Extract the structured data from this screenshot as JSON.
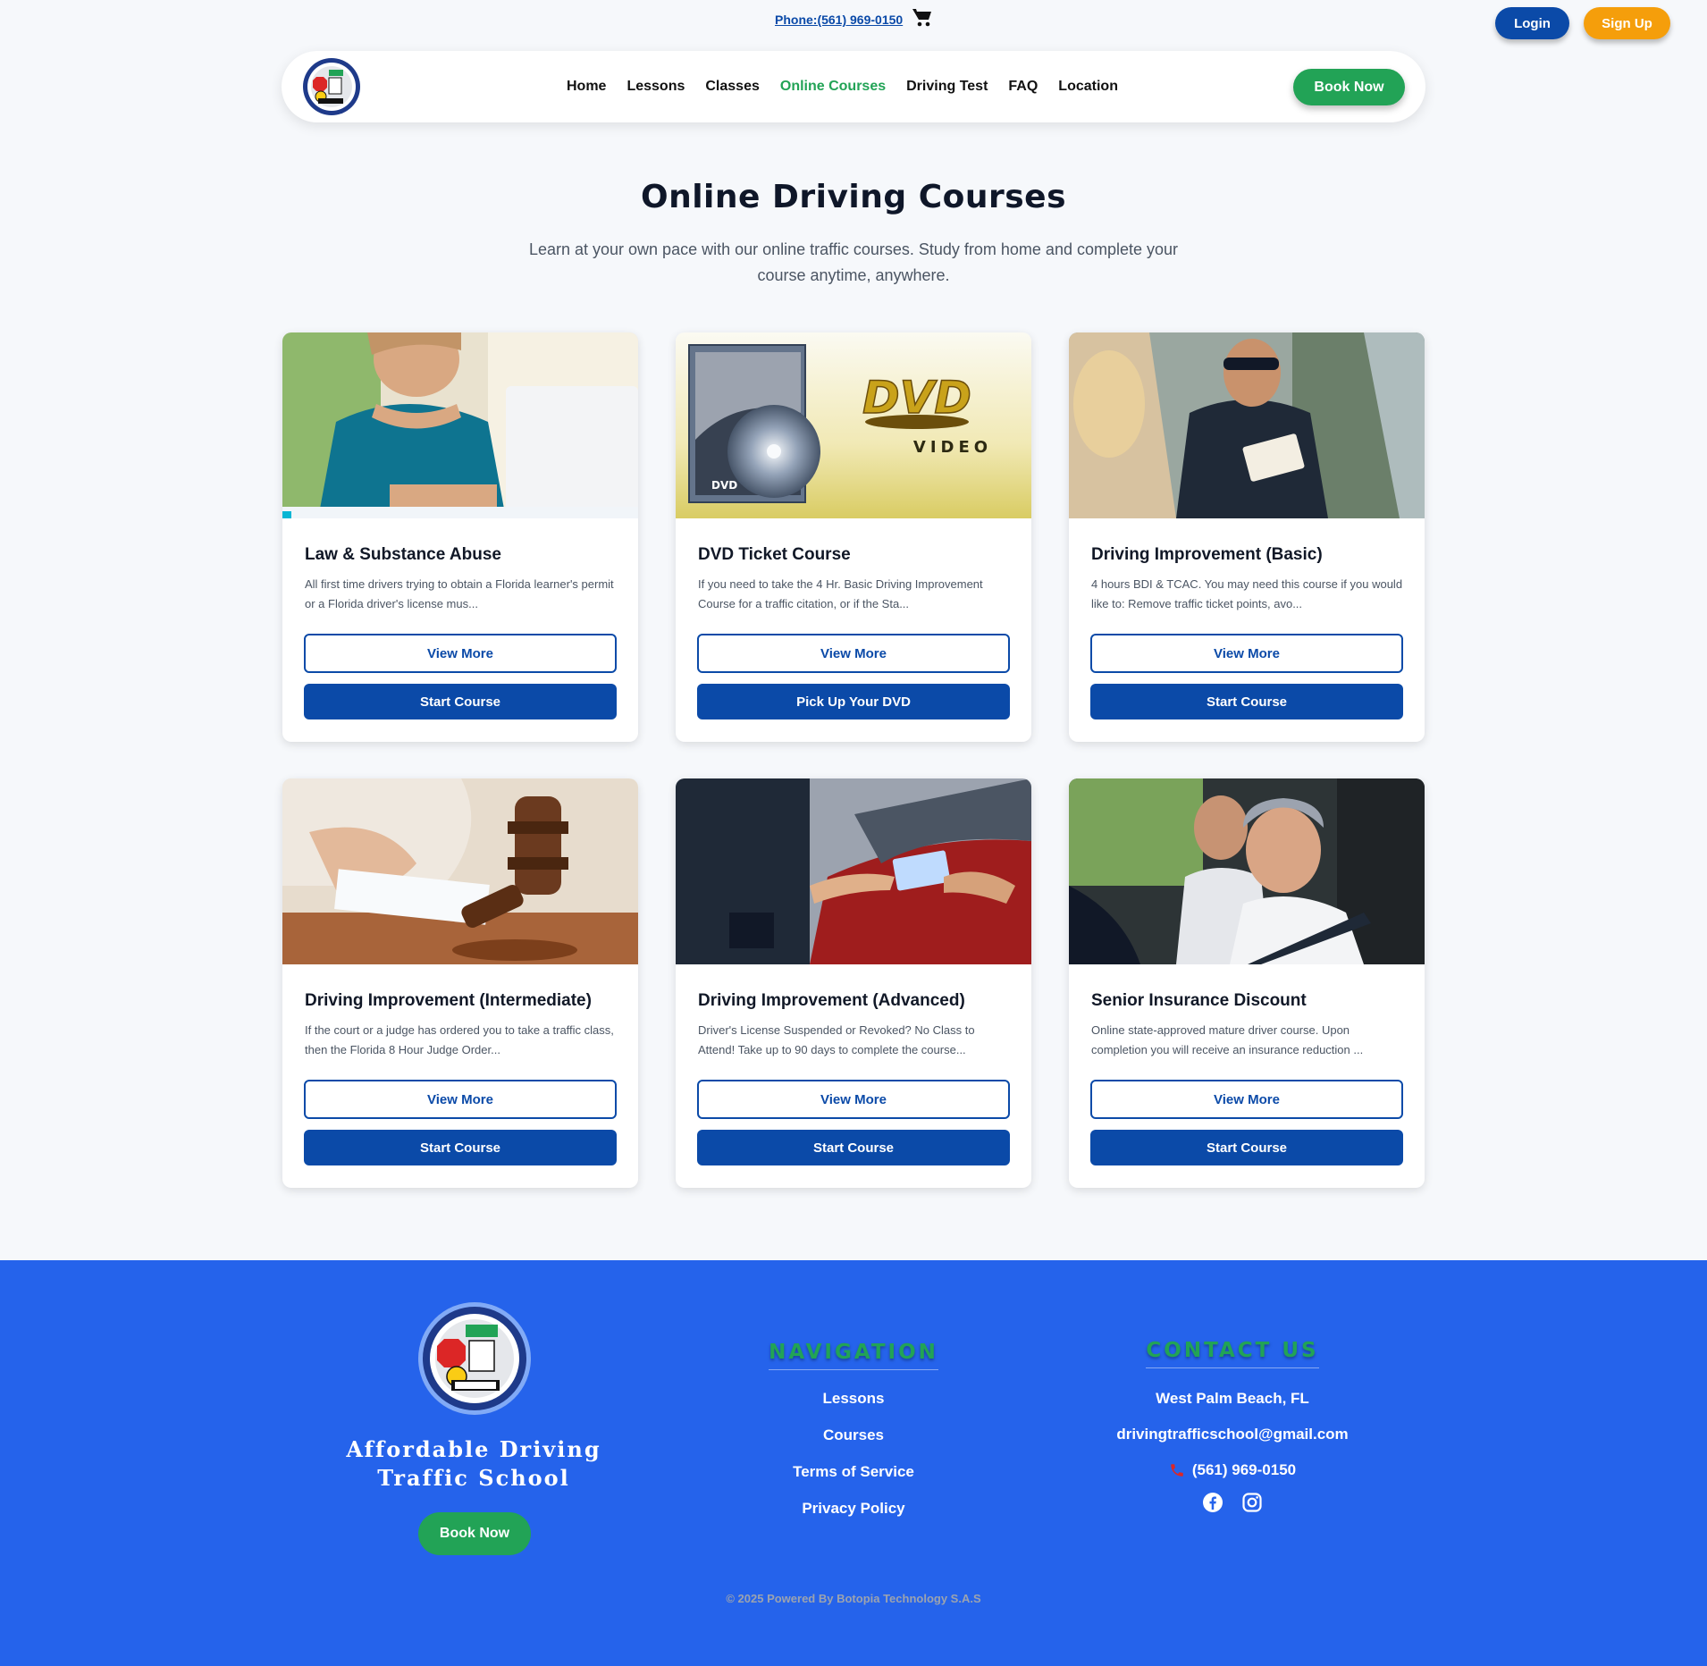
{
  "topbar": {
    "phone_link": "Phone:(561) 969-0150",
    "cart_icon": "cart-icon",
    "login_label": "Login",
    "signup_label": "Sign Up"
  },
  "nav": {
    "logo_icon": "school-logo",
    "items": [
      {
        "label": "Home",
        "active": false
      },
      {
        "label": "Lessons",
        "active": false
      },
      {
        "label": "Classes",
        "active": false
      },
      {
        "label": "Online Courses",
        "active": true
      },
      {
        "label": "Driving Test",
        "active": false
      },
      {
        "label": "FAQ",
        "active": false
      },
      {
        "label": "Location",
        "active": false
      }
    ],
    "book_now_label": "Book Now"
  },
  "hero": {
    "title": "Online Driving Courses",
    "subtitle": "Learn at your own pace with our online traffic courses. Study from home and complete your course anytime, anywhere."
  },
  "courses": [
    {
      "title": "Law & Substance Abuse",
      "description": "All first time drivers trying to obtain a Florida learner's permit or a Florida driver's license mus...",
      "view_more_label": "View More",
      "action_label": "Start Course",
      "image": "woman-laptop-photo"
    },
    {
      "title": "DVD Ticket Course",
      "description": "If you need to take the 4 Hr. Basic Driving Improvement Course for a traffic citation, or if the Sta...",
      "view_more_label": "View More",
      "action_label": "Pick Up Your DVD",
      "image": "dvd-video-photo",
      "image_text": {
        "dvd": "DVD",
        "video": "VIDEO",
        "small": "DVD"
      }
    },
    {
      "title": "Driving Improvement (Basic)",
      "description": "4 hours BDI & TCAC. You may need this course if you would like to: Remove traffic ticket points, avo...",
      "view_more_label": "View More",
      "action_label": "Start Course",
      "image": "police-officer-photo"
    },
    {
      "title": "Driving Improvement (Intermediate)",
      "description": "If the court or a judge has ordered you to take a traffic class, then the Florida 8 Hour Judge Order...",
      "view_more_label": "View More",
      "action_label": "Start Course",
      "image": "gavel-photo"
    },
    {
      "title": "Driving Improvement (Advanced)",
      "description": "Driver's License Suspended or Revoked? No Class to Attend! Take up to 90 days to complete the course...",
      "view_more_label": "View More",
      "action_label": "Start Course",
      "image": "license-handover-photo"
    },
    {
      "title": "Senior Insurance Discount",
      "description": "Online state-approved mature driver course. Upon completion you will receive an insurance reduction ...",
      "view_more_label": "View More",
      "action_label": "Start Course",
      "image": "senior-couple-car-photo"
    }
  ],
  "footer": {
    "logo_icon": "school-logo",
    "brand_line1": "Affordable Driving",
    "brand_line2": "Traffic School",
    "book_now_label": "Book Now",
    "navigation_heading": "NAVIGATION",
    "nav_links": [
      "Lessons",
      "Courses",
      "Terms of Service",
      "Privacy Policy"
    ],
    "contact_heading": "CONTACT US",
    "location": "West Palm Beach, FL",
    "email": "drivingtrafficschool@gmail.com",
    "phone": "(561) 969-0150",
    "phone_icon": "phone-icon",
    "social_icons": [
      "facebook-icon",
      "instagram-icon"
    ],
    "copyright": "© 2025 Powered By Botopia Technology S.A.S"
  },
  "colors": {
    "primary_blue": "#0b4aa8",
    "footer_blue": "#2563eb",
    "green": "#22a356",
    "orange": "#f59e0b"
  }
}
